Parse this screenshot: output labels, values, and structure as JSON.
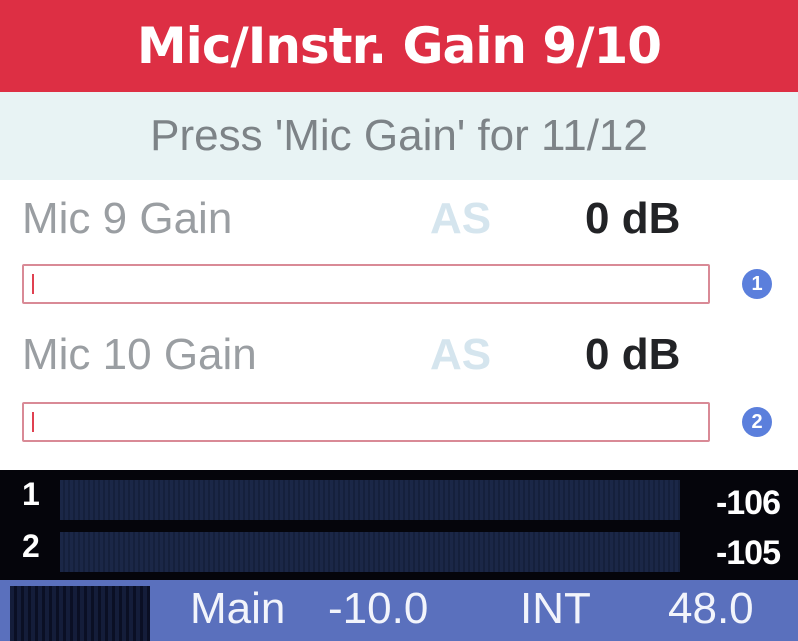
{
  "header": {
    "title": "Mic/Instr. Gain 9/10"
  },
  "subheader": {
    "text": "Press 'Mic Gain' for 11/12"
  },
  "channels": [
    {
      "label": "Mic 9 Gain",
      "as": "AS",
      "value": "0 dB",
      "gain_fraction": 0.0,
      "badge": "1"
    },
    {
      "label": "Mic 10 Gain",
      "as": "AS",
      "value": "0 dB",
      "gain_fraction": 0.0,
      "badge": "2"
    }
  ],
  "meters": [
    {
      "num": "1",
      "value": "-106"
    },
    {
      "num": "2",
      "value": "-105"
    }
  ],
  "footer": {
    "main_label": "Main",
    "main_value": "-10.0",
    "int_label": "INT",
    "int_value": "48.0"
  },
  "colors": {
    "header_bg": "#dd2f44",
    "footer_bg": "#5a70bd",
    "badge": "#5b7fdc"
  }
}
